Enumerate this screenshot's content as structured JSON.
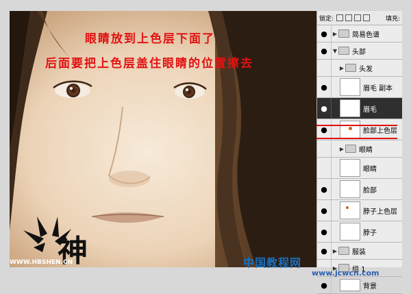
{
  "annotations": {
    "line1": "眼睛放到上色层下面了",
    "line2": "后面要把上色层盖住眼睛的位置擦去"
  },
  "watermark": "WWW.HBSHEN.CN",
  "layers_panel": {
    "lock_label": "锁定:",
    "fill_label": "填充:",
    "layers": [
      {
        "name": "简易色谱",
        "kind": "group",
        "visible": true
      },
      {
        "name": "头部",
        "kind": "group",
        "visible": true,
        "open": true
      },
      {
        "name": "头发",
        "kind": "group",
        "visible": false
      },
      {
        "name": "眉毛 副本",
        "kind": "layer",
        "visible": true
      },
      {
        "name": "眉毛",
        "kind": "layer",
        "visible": true,
        "selected": true
      },
      {
        "name": "脸部上色层",
        "kind": "layer",
        "visible": true
      },
      {
        "name": "眼睛",
        "kind": "group",
        "visible": true
      },
      {
        "name": "眼睛",
        "kind": "layer",
        "visible": false
      },
      {
        "name": "脸部",
        "kind": "layer",
        "visible": true
      },
      {
        "name": "脖子上色层",
        "kind": "layer",
        "visible": true
      },
      {
        "name": "脖子",
        "kind": "layer",
        "visible": true
      },
      {
        "name": "服装",
        "kind": "group",
        "visible": true
      },
      {
        "name": "组 1",
        "kind": "group",
        "visible": false
      },
      {
        "name": "背景",
        "kind": "layer",
        "visible": true
      }
    ]
  },
  "site_logo": {
    "text": "中国教程网",
    "url": "www.jcwcn.com"
  },
  "colors": {
    "annotation_red": "#e21212",
    "selected_layer": "#2f2f2f",
    "skin": "#f1dfcb",
    "hair": "#3a2818"
  }
}
